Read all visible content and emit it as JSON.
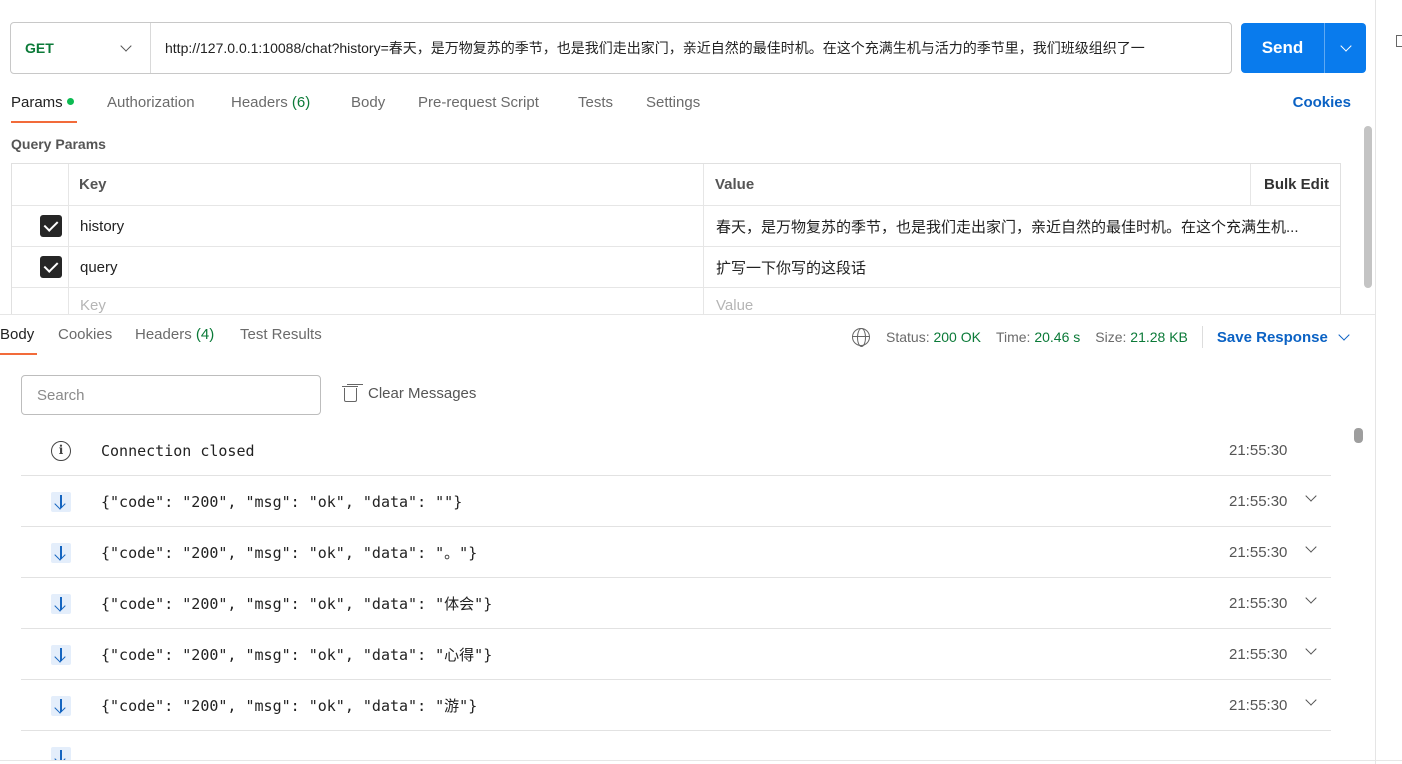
{
  "request": {
    "method": "GET",
    "url": "http://127.0.0.1:10088/chat?history=春天，是万物复苏的季节，也是我们走出家门，亲近自然的最佳时机。在这个充满生机与活力的季节里，我们班级组织了一",
    "send_label": "Send"
  },
  "req_tabs": {
    "params": "Params",
    "authorization": "Authorization",
    "headers": "Headers",
    "headers_count": "(6)",
    "body": "Body",
    "prerequest": "Pre-request Script",
    "tests": "Tests",
    "settings": "Settings",
    "cookies": "Cookies"
  },
  "query_params": {
    "title": "Query Params",
    "col_key": "Key",
    "col_value": "Value",
    "bulk_edit": "Bulk Edit",
    "rows": [
      {
        "key": "history",
        "value": "春天，是万物复苏的季节，也是我们走出家门，亲近自然的最佳时机。在这个充满生机...",
        "checked": true
      },
      {
        "key": "query",
        "value": "扩写一下你写的这段话",
        "checked": true
      }
    ],
    "key_placeholder": "Key",
    "value_placeholder": "Value"
  },
  "response": {
    "tabs": {
      "body": "Body",
      "cookies": "Cookies",
      "headers": "Headers",
      "headers_count": "(4)",
      "test_results": "Test Results"
    },
    "status_label": "Status:",
    "status_value": "200 OK",
    "time_label": "Time:",
    "time_value": "20.46 s",
    "size_label": "Size:",
    "size_value": "21.28 KB",
    "save_response": "Save Response",
    "search_placeholder": "Search",
    "clear_messages": "Clear Messages",
    "messages": [
      {
        "type": "info",
        "text": "Connection closed",
        "time": "21:55:30",
        "expandable": false
      },
      {
        "type": "incoming",
        "text": "{\"code\": \"200\", \"msg\": \"ok\", \"data\": \"\"}",
        "time": "21:55:30",
        "expandable": true
      },
      {
        "type": "incoming",
        "text": "{\"code\": \"200\", \"msg\": \"ok\", \"data\": \"。\"}",
        "time": "21:55:30",
        "expandable": true
      },
      {
        "type": "incoming",
        "text": "{\"code\": \"200\", \"msg\": \"ok\", \"data\": \"体会\"}",
        "time": "21:55:30",
        "expandable": true
      },
      {
        "type": "incoming",
        "text": "{\"code\": \"200\", \"msg\": \"ok\", \"data\": \"心得\"}",
        "time": "21:55:30",
        "expandable": true
      },
      {
        "type": "incoming",
        "text": "{\"code\": \"200\", \"msg\": \"ok\", \"data\": \"游\"}",
        "time": "21:55:30",
        "expandable": true
      }
    ]
  },
  "colors": {
    "accent": "#097bed",
    "method_green": "#0b7a38",
    "tab_underline": "#f26b3a",
    "link_blue": "#0b62c4"
  }
}
